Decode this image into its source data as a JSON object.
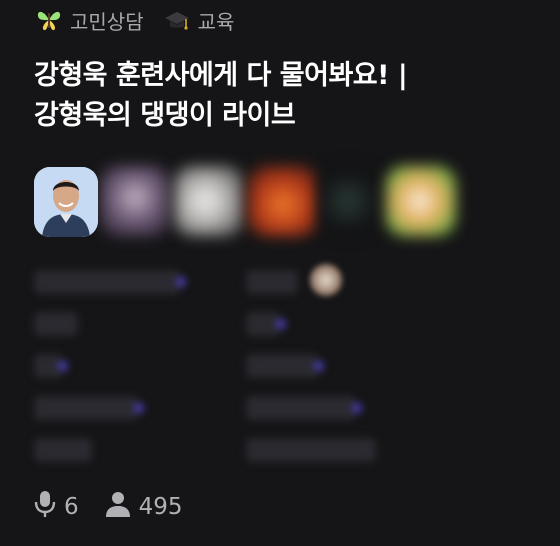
{
  "tags": [
    {
      "label": "고민상담",
      "icon": "butterfly-icon"
    },
    {
      "label": "교육",
      "icon": "graduation-cap-icon"
    }
  ],
  "title": {
    "line1": "강형욱 훈련사에게 다 물어봐요! |",
    "line2": "강형욱의 댕댕이 라이브"
  },
  "stats": {
    "speakers": "6",
    "listeners": "495"
  },
  "colors": {
    "background": "#151517",
    "title": "#ffffff",
    "meta": "#a8a8ad",
    "accent": "#4a3fb8"
  }
}
